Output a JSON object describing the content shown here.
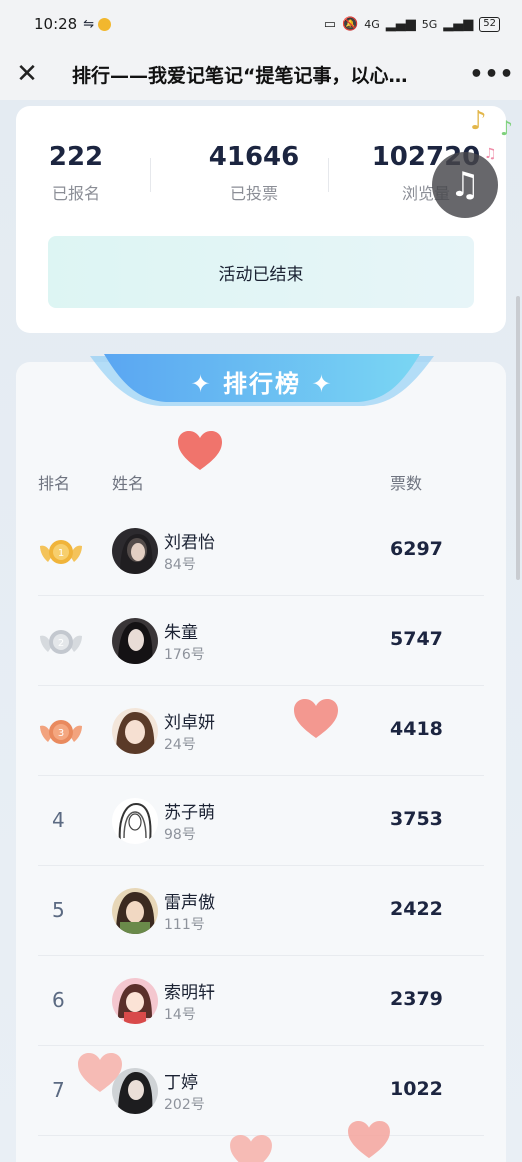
{
  "status_bar": {
    "time": "10:28",
    "signal_text_1": "4G",
    "signal_text_2": "5G",
    "battery": "52"
  },
  "title_bar": {
    "close_icon": "close-icon",
    "title": "排行——我爱记笔记“提笔记事，以心…",
    "more": "•••"
  },
  "stats": [
    {
      "value": "222",
      "label": "已报名"
    },
    {
      "value": "41646",
      "label": "已投票"
    },
    {
      "value": "102720",
      "label": "浏览量"
    }
  ],
  "activity_status": "活动已结束",
  "ranking": {
    "banner": "✦ 排行榜 ✦",
    "headers": {
      "rank": "排名",
      "name": "姓名",
      "votes": "票数"
    },
    "rows": [
      {
        "rank": "1",
        "name": "刘君怡",
        "number": "84号",
        "votes": "6297",
        "medal": "gold"
      },
      {
        "rank": "2",
        "name": "朱童",
        "number": "176号",
        "votes": "5747",
        "medal": "silver"
      },
      {
        "rank": "3",
        "name": "刘卓妍",
        "number": "24号",
        "votes": "4418",
        "medal": "bronze"
      },
      {
        "rank": "4",
        "name": "苏子萌",
        "number": "98号",
        "votes": "3753"
      },
      {
        "rank": "5",
        "name": "雷声傲",
        "number": "111号",
        "votes": "2422"
      },
      {
        "rank": "6",
        "name": "索明轩",
        "number": "14号",
        "votes": "2379"
      },
      {
        "rank": "7",
        "name": "丁婷",
        "number": "202号",
        "votes": "1022"
      }
    ]
  },
  "colors": {
    "accent_blue": "#5bb3f0",
    "gold": "#f0b43a",
    "silver": "#c3c8cf",
    "bronze": "#e98a5e",
    "heart": "#f0746c"
  }
}
